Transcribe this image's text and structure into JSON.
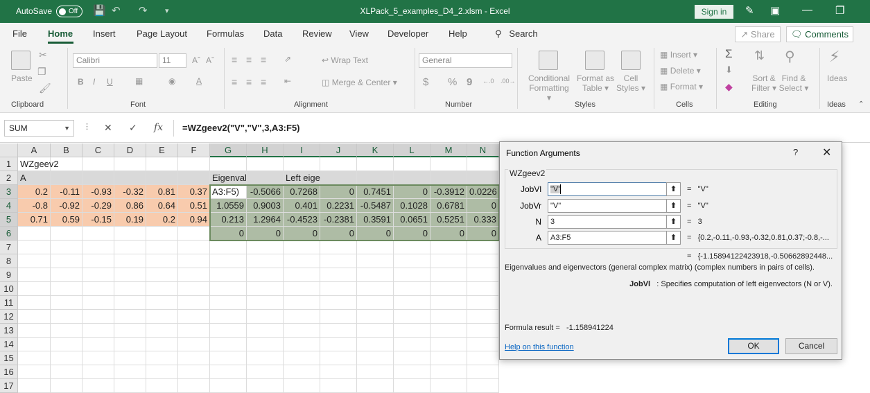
{
  "titlebar": {
    "autosave_label": "AutoSave",
    "autosave_state": "Off",
    "doc_title": "XLPack_5_examples_D4_2.xlsm  -  Excel",
    "signin": "Sign in"
  },
  "tabs": {
    "items": [
      "File",
      "Home",
      "Insert",
      "Page Layout",
      "Formulas",
      "Data",
      "Review",
      "View",
      "Developer",
      "Help"
    ],
    "active": "Home",
    "search": "Search",
    "share": "Share",
    "comments": "Comments"
  },
  "ribbon": {
    "clipboard": {
      "paste": "Paste",
      "label": "Clipboard"
    },
    "font": {
      "name": "Calibri",
      "size": "11",
      "label": "Font",
      "bold": "B",
      "italic": "I",
      "underline": "U"
    },
    "alignment": {
      "wrap": "Wrap Text",
      "merge": "Merge & Center",
      "label": "Alignment"
    },
    "number": {
      "format": "General",
      "label": "Number",
      "currency": "$",
      "percent": "%",
      "comma": "9"
    },
    "styles": {
      "conditional_1": "Conditional",
      "conditional_2": "Formatting",
      "table_1": "Format as",
      "table_2": "Table",
      "cell_1": "Cell",
      "cell_2": "Styles",
      "label": "Styles"
    },
    "cells": {
      "insert": "Insert",
      "delete": "Delete",
      "format": "Format",
      "label": "Cells"
    },
    "editing": {
      "sort_1": "Sort &",
      "sort_2": "Filter",
      "find_1": "Find &",
      "find_2": "Select",
      "label": "Editing"
    },
    "ideas": {
      "button": "Ideas",
      "label": "Ideas"
    }
  },
  "formula_bar": {
    "name_box": "SUM",
    "formula": "=WZgeev2(\"V\",\"V\",3,A3:F5)"
  },
  "grid": {
    "columns": [
      "A",
      "B",
      "C",
      "D",
      "E",
      "F",
      "G",
      "H",
      "I",
      "J",
      "K",
      "L",
      "M",
      "N"
    ],
    "rows": [
      "1",
      "2",
      "3",
      "4",
      "5",
      "6",
      "7",
      "8",
      "9",
      "10",
      "11",
      "12",
      "13",
      "14",
      "15",
      "16",
      "17"
    ],
    "r1": {
      "A": "WZgeev2"
    },
    "r2": {
      "A": "A",
      "G": "Eigenvalues",
      "I": "Left eigenvectors"
    },
    "matrix": [
      [
        "0.2",
        "-0.11",
        "-0.93",
        "-0.32",
        "0.81",
        "0.37"
      ],
      [
        "-0.8",
        "-0.92",
        "-0.29",
        "0.86",
        "0.64",
        "0.51"
      ],
      [
        "0.71",
        "0.59",
        "-0.15",
        "0.19",
        "0.2",
        "0.94"
      ]
    ],
    "results": [
      [
        "A3:F5)",
        "-0.5066",
        "0.7268",
        "0",
        "0.7451",
        "0",
        "-0.3912",
        "0.0226"
      ],
      [
        "1.0559",
        "0.9003",
        "0.401",
        "0.2231",
        "-0.5487",
        "0.1028",
        "0.6781",
        "0"
      ],
      [
        "0.213",
        "1.2964",
        "-0.4523",
        "-0.2381",
        "0.3591",
        "0.0651",
        "0.5251",
        "0.333"
      ],
      [
        "0",
        "0",
        "0",
        "0",
        "0",
        "0",
        "0",
        "0"
      ]
    ]
  },
  "dialog": {
    "title": "Function Arguments",
    "help": "?",
    "function": "WZgeev2",
    "args": [
      {
        "label": "JobVl",
        "value": "\"V\"",
        "result": "\"V\""
      },
      {
        "label": "JobVr",
        "value": "\"V\"",
        "result": "\"V\""
      },
      {
        "label": "N",
        "value": "3",
        "result": "3"
      },
      {
        "label": "A",
        "value": "A3:F5",
        "result": "{0.2,-0.11,-0.93,-0.32,0.81,0.37;-0.8,-..."
      }
    ],
    "eq": "=",
    "total_result": "{-1.15894122423918,-0.50662892448...",
    "description": "Eigenvalues and eigenvectors (general complex matrix) (complex numbers in pairs of cells).",
    "arg_name": "JobVl",
    "arg_desc": ": Specifies computation of left eigenvectors (N or V).",
    "formula_result_label": "Formula result =",
    "formula_result": "-1.158941224",
    "help_link": "Help on this function",
    "ok": "OK",
    "cancel": "Cancel"
  },
  "colors": {
    "excel_green": "#217346",
    "orange_fill": "#f8cbad",
    "gray_fill": "#d9d9d9",
    "selection_fill": "#aebca5"
  }
}
